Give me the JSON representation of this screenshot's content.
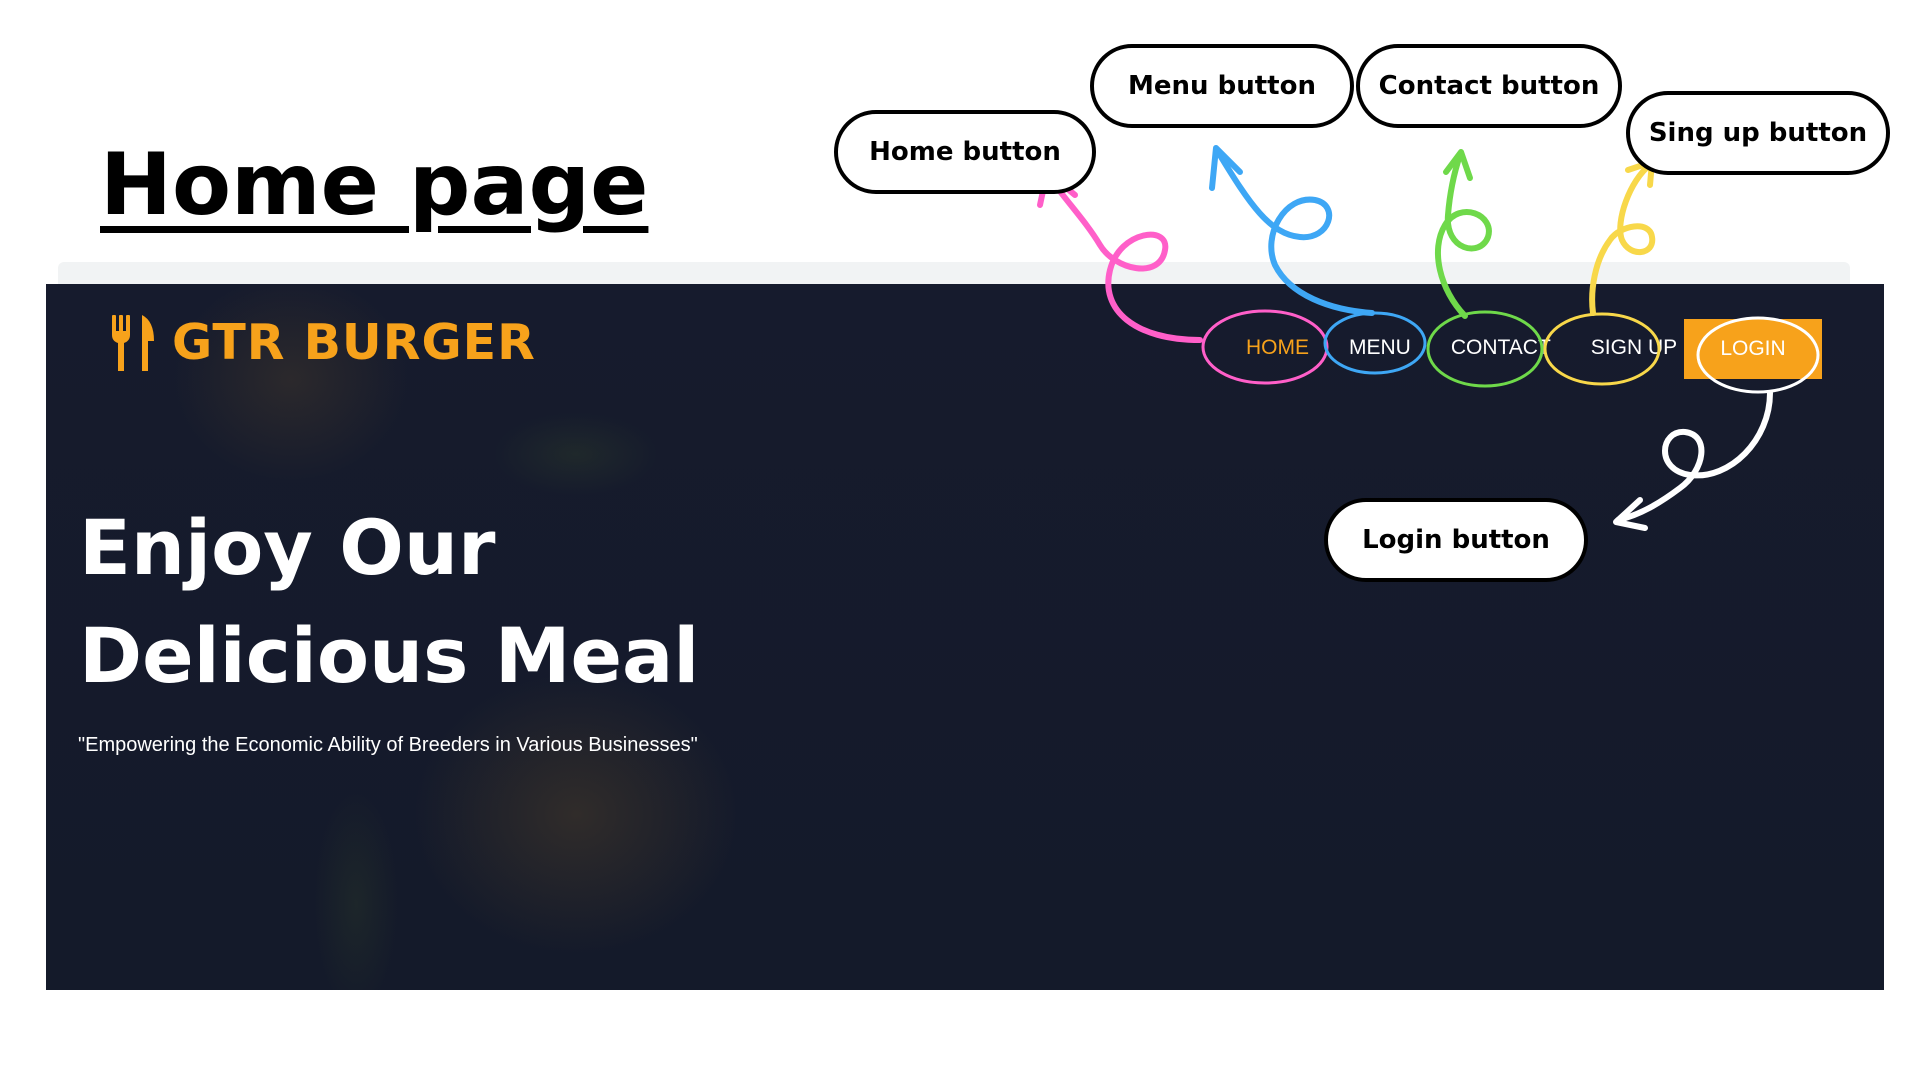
{
  "page_heading": "Home page",
  "site": {
    "brand_name": "GTR BURGER",
    "brand_icon": "fork-knife-icon",
    "accent_color": "#f7a21b",
    "background_color": "#161b2d"
  },
  "nav": {
    "home": "HOME",
    "menu": "MENU",
    "contact": "CONTACT",
    "signup": "SIGN UP",
    "login": "LOGIN",
    "active": "HOME"
  },
  "hero": {
    "title_line1": "Enjoy Our",
    "title_line2": "Delicious Meal",
    "tagline": "\"Empowering the Economic Ability of Breeders in Various Businesses\""
  },
  "annotations": {
    "home": {
      "label": "Home button",
      "color": "#ff5fc9"
    },
    "menu": {
      "label": "Menu button",
      "color": "#3ea7f5"
    },
    "contact": {
      "label": "Contact button",
      "color": "#6fd94a"
    },
    "signup": {
      "label": "Sing up button",
      "color": "#f8d84a"
    },
    "login": {
      "label": "Login button",
      "color": "#ffffff"
    }
  }
}
